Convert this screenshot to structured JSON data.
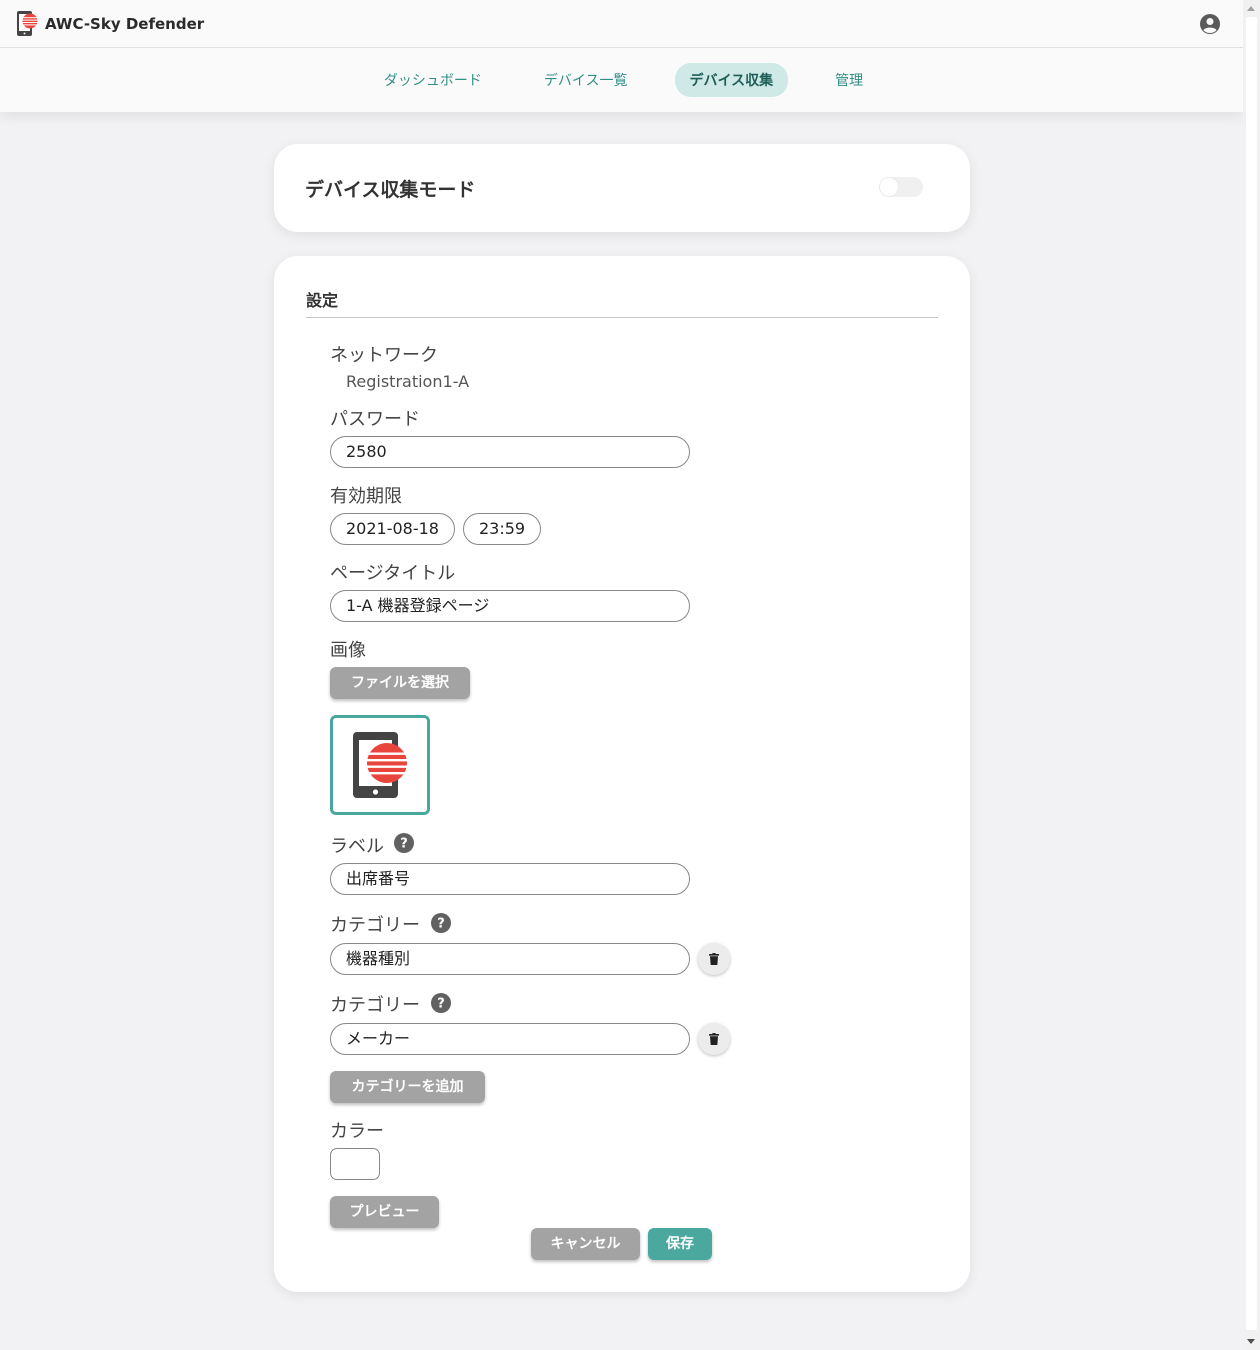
{
  "header": {
    "app_title": "AWC-Sky Defender",
    "nav": [
      {
        "label": "ダッシュボード",
        "active": false
      },
      {
        "label": "デバイス一覧",
        "active": false
      },
      {
        "label": "デバイス収集",
        "active": true
      },
      {
        "label": "管理",
        "active": false
      }
    ]
  },
  "mode_card": {
    "title": "デバイス収集モード",
    "toggle_on": false
  },
  "settings": {
    "title": "設定",
    "network": {
      "label": "ネットワーク",
      "value": "Registration1-A"
    },
    "password": {
      "label": "パスワード",
      "value": "2580"
    },
    "expiry": {
      "label": "有効期限",
      "date": "2021-08-18",
      "time": "23:59"
    },
    "page_title": {
      "label": "ページタイトル",
      "value": "1-A 機器登録ページ"
    },
    "image": {
      "label": "画像",
      "choose_file_label": "ファイルを選択"
    },
    "label_field": {
      "label": "ラベル",
      "value": "出席番号"
    },
    "categories": [
      {
        "label": "カテゴリー",
        "value": "機器種別"
      },
      {
        "label": "カテゴリー",
        "value": "メーカー"
      }
    ],
    "add_category_label": "カテゴリーを追加",
    "color": {
      "label": "カラー",
      "value": "#ffffff"
    },
    "preview_label": "プレビュー",
    "cancel_label": "キャンセル",
    "save_label": "保存"
  },
  "colors": {
    "accent": "#4aa89e",
    "nav_active_bg": "#cfe9e6",
    "brand_red": "#e8453c"
  }
}
